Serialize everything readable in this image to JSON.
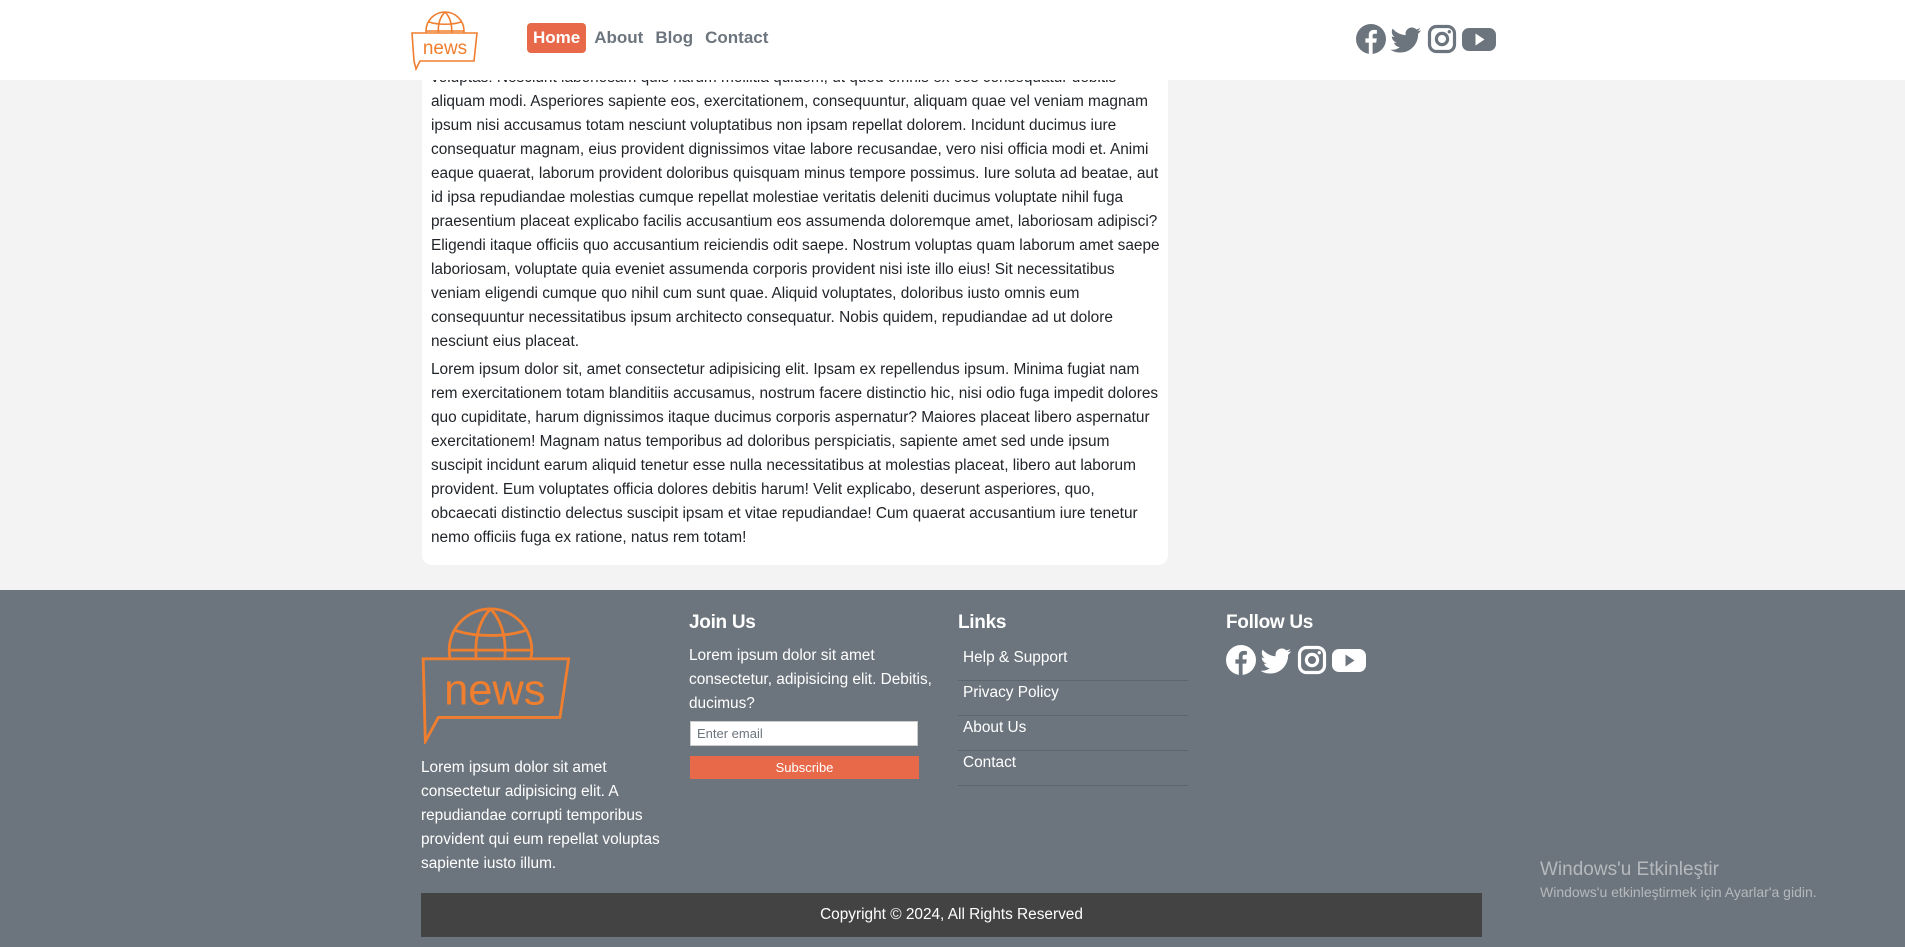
{
  "brand": {
    "logo_text": "news",
    "accent": "#e8694a",
    "logo_color": "#f07e2f"
  },
  "nav": {
    "items": [
      {
        "label": "Home",
        "active": true
      },
      {
        "label": "About",
        "active": false
      },
      {
        "label": "Blog",
        "active": false
      },
      {
        "label": "Contact",
        "active": false
      }
    ]
  },
  "social_icons": [
    "facebook-icon",
    "twitter-icon",
    "instagram-icon",
    "youtube-icon"
  ],
  "article": {
    "paragraphs": [
      "voluptas! Nesciunt laboriosam quis harum mollitia quidem, ut quod omnis ex eos consequatur debitis aliquam modi. Asperiores sapiente eos, exercitationem, consequuntur, aliquam quae vel veniam magnam ipsum nisi accusamus totam nesciunt voluptatibus non ipsam repellat dolorem. Incidunt ducimus iure consequatur magnam, eius provident dignissimos vitae labore recusandae, vero nisi officia modi et. Animi eaque quaerat, laborum provident doloribus quisquam minus tempore possimus. Iure soluta ad beatae, aut id ipsa repudiandae molestias cumque repellat molestiae veritatis deleniti ducimus voluptate nihil fuga praesentium placeat explicabo facilis accusantium eos assumenda doloremque amet, laboriosam adipisci? Eligendi itaque officiis quo accusantium reiciendis odit saepe. Nostrum voluptas quam laborum amet saepe laboriosam, voluptate quia eveniet assumenda corporis provident nisi iste illo eius! Sit necessitatibus veniam eligendi cumque quo nihil cum sunt quae. Aliquid voluptates, doloribus iusto omnis eum consequuntur necessitatibus ipsum architecto consequatur. Nobis quidem, repudiandae ad ut dolore nesciunt eius placeat.",
      "Lorem ipsum dolor sit, amet consectetur adipisicing elit. Ipsam ex repellendus ipsum. Minima fugiat nam rem exercitationem totam blanditiis accusamus, nostrum facere distinctio hic, nisi odio fuga impedit dolores quo cupiditate, harum dignissimos itaque ducimus corporis aspernatur? Maiores placeat libero aspernatur exercitationem! Magnam natus temporibus ad doloribus perspiciatis, sapiente amet sed unde ipsum suscipit incidunt earum aliquid tenetur esse nulla necessitatibus at molestias placeat, libero aut laborum provident. Eum voluptates officia dolores debitis harum! Velit explicabo, deserunt asperiores, quo, obcaecati distinctio delectus suscipit ipsam et vitae repudiandae! Cum quaerat accusantium iure tenetur nemo officiis fuga ex ratione, natus rem totam!"
    ]
  },
  "footer": {
    "about_text": "Lorem ipsum dolor sit amet consectetur adipisicing elit. A repudiandae corrupti temporibus provident qui eum repellat voluptas sapiente iusto illum.",
    "join": {
      "title": "Join Us",
      "text": "Lorem ipsum dolor sit amet consectetur, adipisicing elit. Debitis, ducimus?",
      "email_placeholder": "Enter email",
      "subscribe_label": "Subscribe"
    },
    "links": {
      "title": "Links",
      "items": [
        "Help & Support",
        "Privacy Policy",
        "About Us",
        "Contact"
      ]
    },
    "follow": {
      "title": "Follow Us"
    },
    "copyright": "Copyright © 2024, All Rights Reserved"
  },
  "watermark": {
    "title": "Windows'u Etkinleştir",
    "subtitle": "Windows'u etkinleştirmek için Ayarlar'a gidin."
  }
}
